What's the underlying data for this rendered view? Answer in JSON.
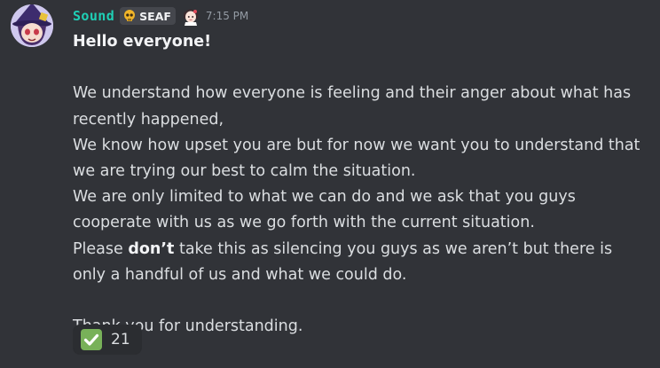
{
  "message": {
    "author": "Sound",
    "clan_tag": "SEAF",
    "timestamp": "7:15 PM",
    "greeting": "Hello everyone!",
    "lines": [
      "We understand how everyone is feeling and their anger about what has recently happened,",
      "We know how upset you are but for now we want you to understand that we are trying our best to calm the situation.",
      "We are only limited to what we can do and we ask that you guys cooperate with us as we go forth with the current situation."
    ],
    "last_line": {
      "before": "Please ",
      "bold": "don’t",
      "after": " take this as silencing you guys as we aren’t but there is only a handful of us and what we could do."
    },
    "closing": "Thank you for understanding."
  },
  "reaction": {
    "emoji": "white-check-mark-icon",
    "count": "21"
  },
  "icons": {
    "avatar": "avatar-anime-witch",
    "clan_badge": "skull-badge-icon",
    "role_icon": "role-character-icon"
  },
  "colors": {
    "background": "#313338",
    "username": "#1fcfb5",
    "text": "#dbdee1",
    "timestamp": "#949ba4",
    "reaction_bg": "#2b2d31",
    "check_green": "#78b159"
  }
}
